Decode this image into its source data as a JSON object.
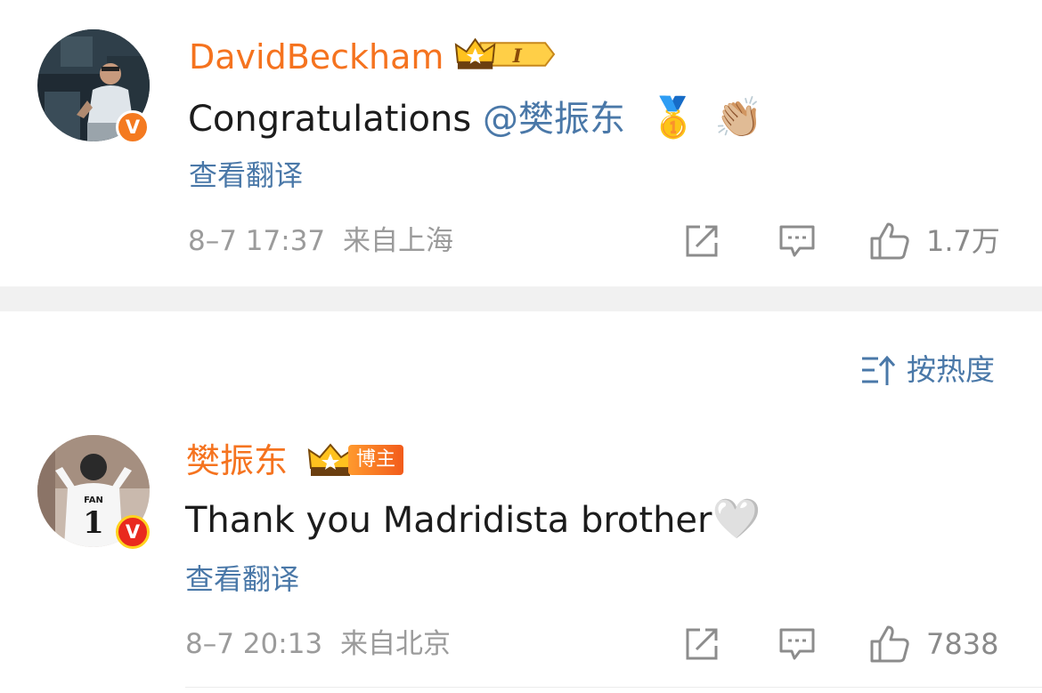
{
  "comments": [
    {
      "username": "DavidBeckham",
      "badge_level": "I",
      "text": "Congratulations",
      "mention": "@樊振东",
      "emoji_1": "🥇",
      "emoji_2": "👏🏼",
      "translate_label": "查看翻译",
      "timestamp": "8–7 17:37",
      "location": "来自上海",
      "like_count": "1.7万",
      "verified_glyph": "V"
    },
    {
      "username": "樊振东",
      "badge_tag": "博主",
      "text": "Thank you Madridista brother",
      "emoji_1": "🤍",
      "translate_label": "查看翻译",
      "timestamp": "8–7 20:13",
      "location": "来自北京",
      "like_count": "7838",
      "verified_glyph": "V",
      "avatar_jersey_name": "FAN",
      "avatar_jersey_number": "1"
    }
  ],
  "sort": {
    "label": "按热度"
  },
  "colors": {
    "username": "#f5731f",
    "link": "#4a78a8",
    "meta": "#9b9b9b",
    "verified_orange": "#f47a20",
    "verified_red": "#e9291e"
  }
}
